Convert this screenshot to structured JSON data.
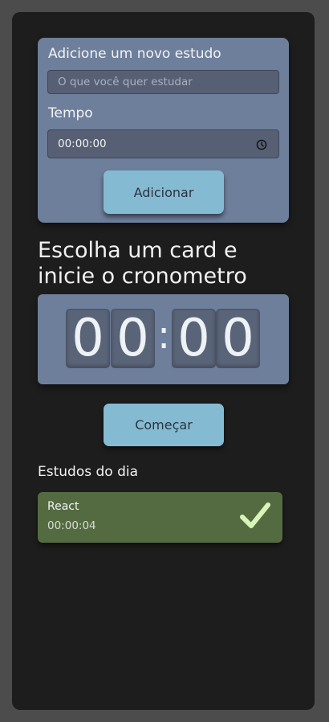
{
  "form": {
    "task_label": "Adicione um novo estudo",
    "task_placeholder": "O que você quer estudar",
    "time_label": "Tempo",
    "time_value": "00:00:00",
    "time_icon": "clock-icon",
    "add_button": "Adicionar"
  },
  "stopwatch": {
    "heading": "Escolha um card e inicie o cronometro",
    "digits": [
      "0",
      "0",
      "0",
      "0"
    ],
    "separator": ":",
    "start_button": "Começar"
  },
  "studies": {
    "title": "Estudos do dia",
    "items": [
      {
        "name": "React",
        "time": "00:00:04",
        "status_icon": "check-icon"
      }
    ]
  },
  "colors": {
    "card": "#6e7f9c",
    "button": "#85bbd2",
    "completed_card": "#546b42",
    "check": "#d8f5b8"
  }
}
